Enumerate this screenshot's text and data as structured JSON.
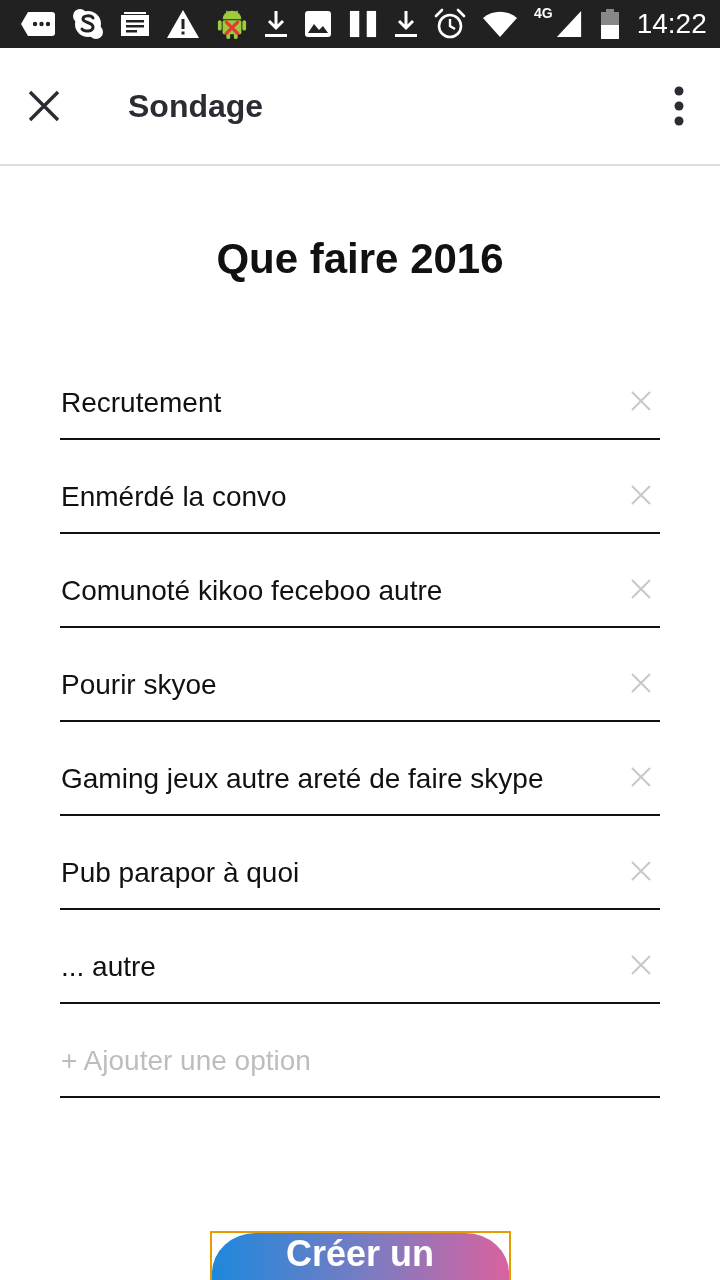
{
  "status_bar": {
    "network_type": "4G",
    "time": "14:22"
  },
  "app_bar": {
    "title": "Sondage"
  },
  "poll": {
    "question": "Que faire 2016",
    "options": [
      {
        "value": "Recrutement"
      },
      {
        "value": "Enmérdé la convo"
      },
      {
        "value": "Comunoté kikoo feceboo autre"
      },
      {
        "value": "Pourir skyoe"
      },
      {
        "value": "Gaming jeux autre areté de faire skype"
      },
      {
        "value": "Pub parapor à quoi"
      },
      {
        "value": "... autre"
      }
    ],
    "add_option": {
      "placeholder": "+ Ajouter une option"
    }
  },
  "submit_button": {
    "label": "Créer un",
    "focused": true
  }
}
